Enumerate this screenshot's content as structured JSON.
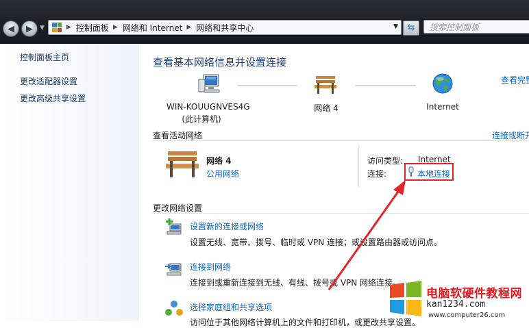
{
  "address_bar": {
    "crumbs": [
      "控制面板",
      "网络和 Internet",
      "网络和共享中心"
    ],
    "search_placeholder": "搜索控制面板"
  },
  "left_pane": {
    "home_link": "控制面板主页",
    "links": [
      "更改适配器设置",
      "更改高级共享设置"
    ]
  },
  "main": {
    "title": "查看基本网络信息并设置连接",
    "view_full_map": "查看完整",
    "network_map": {
      "computer_name": "WIN-KOUUGNVES4G",
      "computer_sub": "(此计算机)",
      "network_name": "网络 4",
      "internet": "Internet"
    },
    "active_section_title": "查看活动网络",
    "connect_disconnect": "连接或断开",
    "active_network": {
      "name": "网络 4",
      "type": "公用网络",
      "access_type_label": "访问类型:",
      "access_type_value": "Internet",
      "connection_label": "连接:",
      "connection_value": "本地连接"
    },
    "change_section_title": "更改网络设置",
    "tasks": [
      {
        "link": "设置新的连接或网络",
        "desc": "设置无线、宽带、拨号、临时或 VPN 连接；或设置路由器或访问点。"
      },
      {
        "link": "连接到网络",
        "desc": "连接到或重新连接到无线、有线、拨号或 VPN 网络连接。"
      },
      {
        "link": "选择家庭组和共享选项",
        "desc": "访问位于其他网络计算机上的文件和打印机，或更改共享设置。"
      }
    ]
  },
  "watermark": {
    "title": "电脑软硬件教程网",
    "url1": "kan1234.com",
    "url2": "www.computer26.com"
  },
  "colors": {
    "link": "#0a6ad1",
    "title": "#1e3c7a",
    "highlight": "#e4242b"
  }
}
